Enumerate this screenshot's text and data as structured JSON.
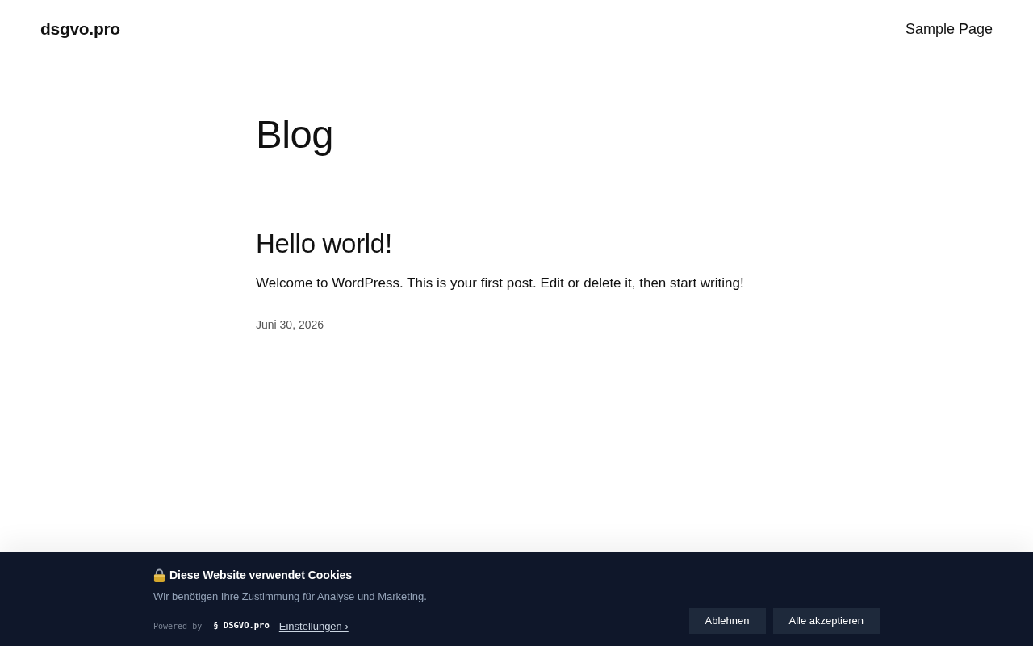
{
  "header": {
    "site_title": "dsgvo.pro",
    "nav": [
      {
        "label": "Sample Page"
      }
    ]
  },
  "page": {
    "title": "Blog",
    "posts": [
      {
        "title": "Hello world!",
        "excerpt": "Welcome to WordPress. This is your first post. Edit or delete it, then start writing!",
        "date": "Juni 30, 2026"
      }
    ]
  },
  "cookie_banner": {
    "title": "Diese Website verwendet Cookies",
    "message": "Wir benötigen Ihre Zustimmung für Analyse und Marketing.",
    "powered_by": "Powered by",
    "brand": "§ DSGVO.pro",
    "settings_link": "Einstellungen ›",
    "buttons": [
      {
        "label": "Ablehnen"
      },
      {
        "label": "Alle akzeptieren"
      }
    ]
  }
}
